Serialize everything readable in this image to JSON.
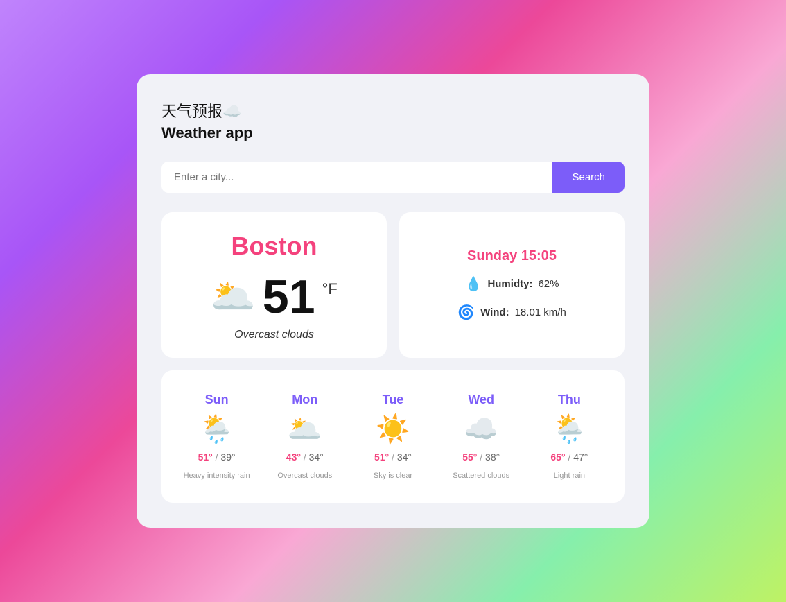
{
  "app": {
    "title_cn": "天气预报☁️",
    "title_en": "Weather app"
  },
  "search": {
    "placeholder": "Enter a city...",
    "button_label": "Search"
  },
  "current": {
    "city": "Boston",
    "temperature": "51",
    "unit": "°F",
    "description": "Overcast clouds",
    "icon": "🌥️"
  },
  "details": {
    "datetime": "Sunday 15:05",
    "humidity_label": "Humidty:",
    "humidity_value": "62%",
    "wind_label": "Wind:",
    "wind_value": "18.01 km/h",
    "humidity_icon": "💧",
    "wind_icon": "🌀"
  },
  "forecast": [
    {
      "day": "Sun",
      "icon": "🌦️",
      "high": "51°",
      "low": "39°",
      "desc": "Heavy intensity rain"
    },
    {
      "day": "Mon",
      "icon": "🌥️",
      "high": "43°",
      "low": "34°",
      "desc": "Overcast clouds"
    },
    {
      "day": "Tue",
      "icon": "☀️",
      "high": "51°",
      "low": "34°",
      "desc": "Sky is clear"
    },
    {
      "day": "Wed",
      "icon": "☁️",
      "high": "55°",
      "low": "38°",
      "desc": "Scattered clouds"
    },
    {
      "day": "Thu",
      "icon": "🌦️",
      "high": "65°",
      "low": "47°",
      "desc": "Light rain"
    }
  ]
}
